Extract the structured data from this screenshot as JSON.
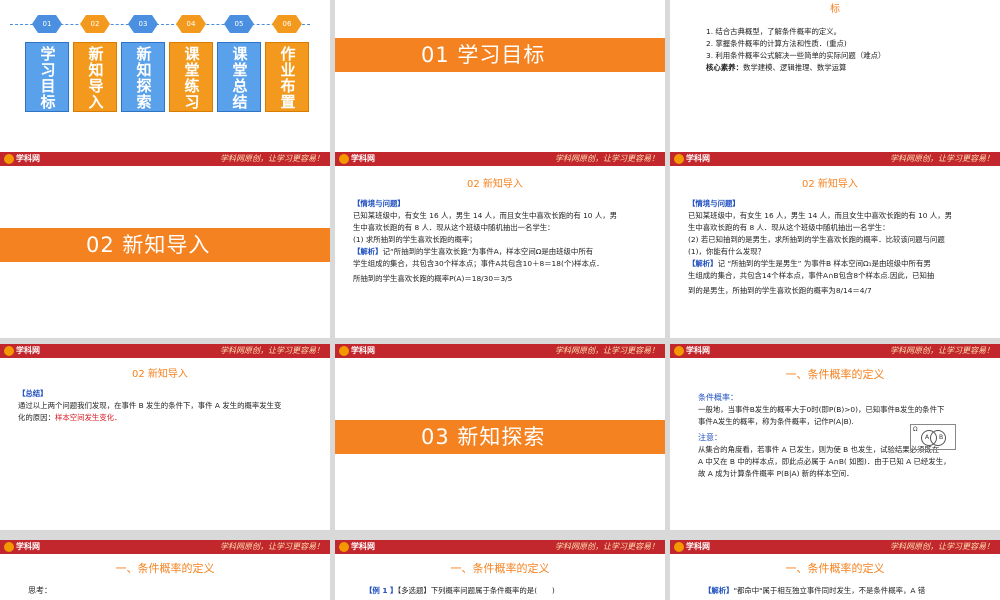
{
  "common": {
    "logo": "学科网",
    "motto": "学科网原创，让学习更容易！"
  },
  "slide1": {
    "numbers": [
      "01",
      "02",
      "03",
      "04",
      "05",
      "06"
    ],
    "steps": [
      "学习目标",
      "新知导入",
      "新知探索",
      "课堂练习",
      "课堂总结",
      "作业布置"
    ]
  },
  "slide2": {
    "banner": "01  学习目标"
  },
  "slide3": {
    "heading": "标",
    "items": [
      "1. 结合古典概型，了解条件概率的定义。",
      "2. 掌握条件概率的计算方法和性质．(重点)",
      "3. 利用条件概率公式解决一些简单的实际问题（难点）"
    ],
    "core_label": "核心素养：",
    "core_text": "数学建模、逻辑推理、数学运算"
  },
  "slide4": {
    "banner": "02  新知导入"
  },
  "slide5": {
    "title": "02  新知导入",
    "label": "【情境与问题】",
    "lines": [
      "已知某班级中，有女生 16 人，男生 14 人，而且女生中喜欢长跑的有 10 人，男",
      "生中喜欢长跑的有 8 人．现从这个班级中随机抽出一名学生：",
      "(1) 求所抽到的学生喜欢长跑的概率；"
    ],
    "analysis_label": "【解析】",
    "analysis_lines": [
      "记“所抽到的学生喜欢长跑”为事件A，样本空间Ω是由班级中所有",
      "学生组成的集合，共包含30个样本点；事件A共包含10＋8＝18(个)样本点．",
      "所抽到的学生喜欢长跑的概率P(A)＝18/30＝3/5"
    ]
  },
  "slide6": {
    "title": "02  新知导入",
    "label": "【情境与问题】",
    "lines": [
      "已知某班级中，有女生 16 人，男生 14 人，而且女生中喜欢长跑的有 10 人，男",
      "生中喜欢长跑的有 8 人．现从这个班级中随机抽出一名学生：",
      "(2) 若已知抽到的是男生，求所抽到的学生喜欢长跑的概率．比较该问题与问题",
      "(1)，你能有什么发现？"
    ],
    "analysis_label": "【解析】",
    "analysis_lines": [
      "记 “所抽到的学生是男生” 为事件B 样本空间Ω₁是由班级中所有男",
      "生组成的集合，共包含14个样本点，事件A∩B包含8个样本点.因此，已知抽",
      "到的是男生，所抽到的学生喜欢长跑的概率为8/14＝4/7"
    ]
  },
  "slide7": {
    "title": "02  新知导入",
    "label": "【总结】",
    "lines": [
      "通过以上两个问题我们发现，在事件 B 发生的条件下，事件 A 发生的概率发生变",
      "化的原因："
    ],
    "red": "样本空间发生变化．"
  },
  "slide8": {
    "banner": "03  新知探索"
  },
  "slide9": {
    "title": "一、条件概率的定义",
    "sub1": "条件概率：",
    "def_lines": [
      "一般地，当事件B发生的概率大于0时(即P(B)>0)，已知事件B发生的条件下",
      "事件A发生的概率，称为条件概率，记作P(A|B)."
    ],
    "sub2": "注意：",
    "note_lines": [
      "从集合的角度看，若事件 A 已发生，则为使 B 也发生，试验结果必须既在",
      "A 中又在 B 中的样本点，即此点必属于 A∩B( 如图)．由于已知 A 已经发生，",
      "故 A 成为计算条件概率 P(B|A) 新的样本空间．"
    ],
    "venn": {
      "omega": "Ω",
      "a": "A",
      "b": "B"
    }
  },
  "slide10": {
    "title": "一、条件概率的定义",
    "text": "思考："
  },
  "slide11": {
    "title": "一、条件概率的定义",
    "label": "【例 1 】",
    "text": "【多选题】下列概率问题属于条件概率的是(　　)"
  },
  "slide12": {
    "title": "一、条件概率的定义",
    "label": "【解析】",
    "text": "\"都命中\"属于相互独立事件同时发生，不是条件概率，A 错"
  }
}
